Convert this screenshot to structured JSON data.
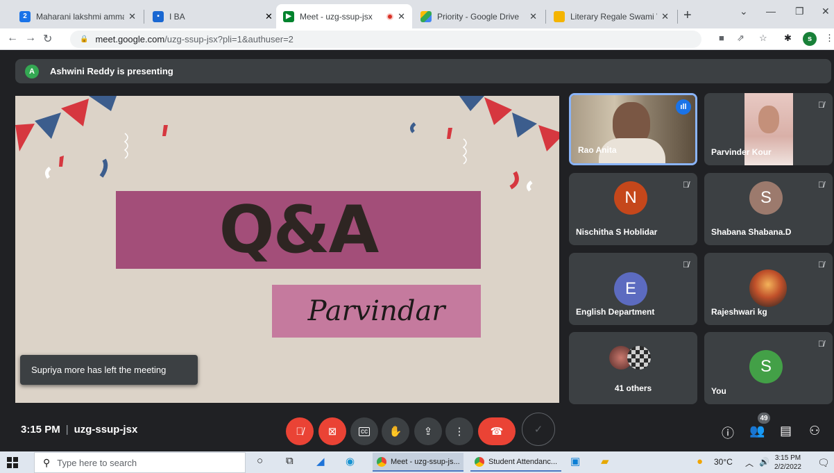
{
  "browser": {
    "tabs": [
      {
        "title": "Maharani lakshmi ammanni c",
        "icon": "calendar-icon",
        "close": "✕"
      },
      {
        "title": "I BA",
        "icon": "classroom-icon",
        "close": ""
      },
      {
        "title": "Meet - uzg-ssup-jsx",
        "icon": "meet-icon",
        "close": "✕"
      },
      {
        "title": "Priority - Google Drive",
        "icon": "drive-icon",
        "close": "✕"
      },
      {
        "title": "Literary Regale Swami Viveka",
        "icon": "slides-icon",
        "close": "✕"
      }
    ],
    "calendar_icon_text": "2",
    "new_tab": "+",
    "url_domain": "meet.google.com",
    "url_path": "/uzg-ssup-jsx?pli=1&authuser=2",
    "profile_initial": "s"
  },
  "meet": {
    "presenting_initial": "A",
    "presenting_text": "Ashwini Reddy is presenting",
    "slide": {
      "heading": "Q&A",
      "name": "Parvindar"
    },
    "toast": "Supriya more has left the meeting",
    "participants": [
      {
        "name": "Rao Anita",
        "type": "video",
        "speaking": true
      },
      {
        "name": "Parvinder Kour",
        "type": "video",
        "muted": true
      },
      {
        "name": "Nischitha S Hoblidar",
        "initial": "N",
        "color": "#c5471b",
        "muted": true
      },
      {
        "name": "Shabana Shabana.D",
        "initial": "S",
        "color": "#9c7a6d",
        "muted": true
      },
      {
        "name": "English Department",
        "initial": "E",
        "color": "#5c6bc0",
        "muted": true
      },
      {
        "name": "Rajeshwari kg",
        "type": "photo",
        "muted": true
      },
      {
        "name": "41 others",
        "type": "group"
      },
      {
        "name": "You",
        "initial": "S",
        "color": "#43a047",
        "muted": true
      }
    ],
    "time": "3:15 PM",
    "meeting_code": "uzg-ssup-jsx",
    "people_count": "49"
  },
  "taskbar": {
    "search_placeholder": "Type here to search",
    "tasks": [
      "Meet - uzg-ssup-js...",
      "Student Attendanc..."
    ],
    "weather": "30°C",
    "clock_time": "3:15 PM",
    "clock_date": "2/2/2022"
  },
  "colors": {
    "meet_bg": "#202124",
    "tile_bg": "#3c4043",
    "end_call": "#ea4335",
    "slide_bg": "#dcd3c8",
    "qa_box": "#a34e79",
    "name_box": "#c57a9e"
  }
}
